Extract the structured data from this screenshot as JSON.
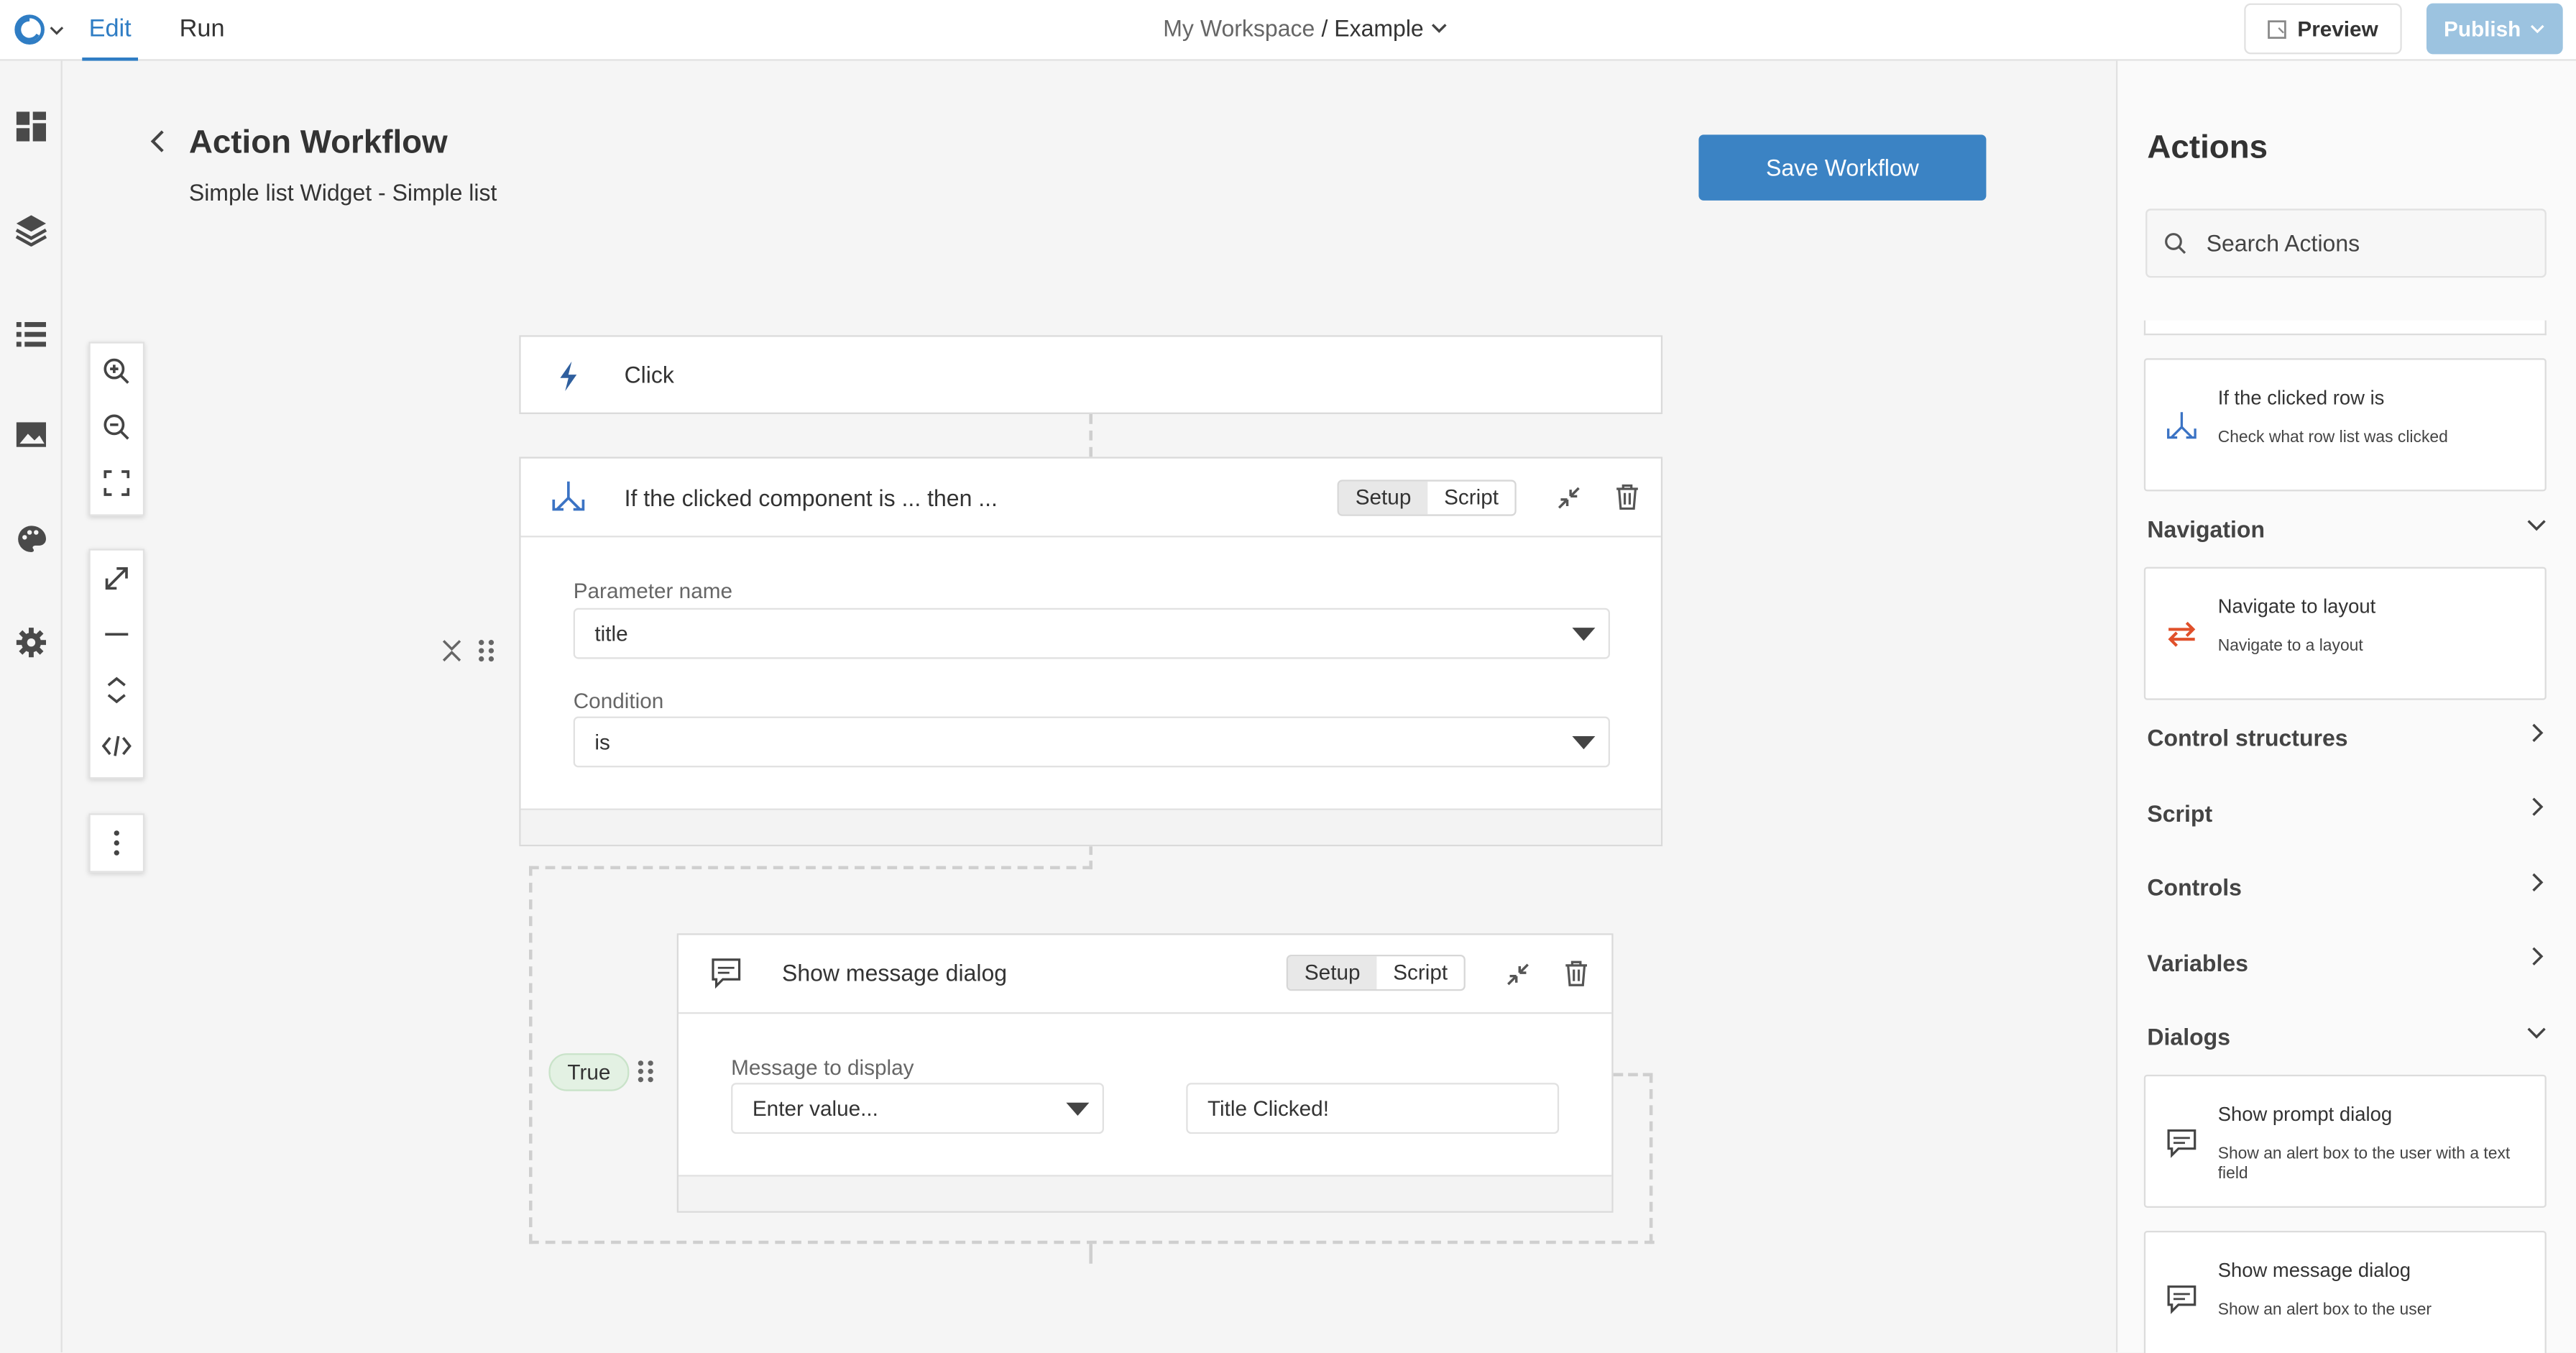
{
  "topbar": {
    "tabs": [
      {
        "label": "Edit",
        "active": true
      },
      {
        "label": "Run",
        "active": false
      }
    ],
    "breadcrumb": {
      "workspace": "My Workspace",
      "project": "/ Example"
    },
    "preview_label": "Preview",
    "publish_label": "Publish"
  },
  "sidebar": {
    "icons": [
      "dashboard-icon",
      "layers-icon",
      "list-icon",
      "image-icon",
      "palette-icon",
      "gear-icon"
    ]
  },
  "header": {
    "title": "Action Workflow",
    "subtitle": "Simple list Widget - Simple list",
    "save_label": "Save Workflow"
  },
  "toolbar": {
    "group1": [
      "zoom-in-icon",
      "zoom-out-icon",
      "fit-screen-icon"
    ],
    "group2": [
      "expand-icon",
      "collapse-icon",
      "expand-vertical-icon",
      "code-icon"
    ],
    "group3": [
      "more-vertical-icon"
    ]
  },
  "workflow": {
    "trigger": {
      "label": "Click",
      "icon": "lightning-icon"
    },
    "condition_block": {
      "title": "If the clicked component is ... then ...",
      "icon": "branch-icon",
      "tabs": [
        "Setup",
        "Script"
      ],
      "active_tab": "Setup",
      "fields": [
        {
          "label": "Parameter name",
          "value": "title"
        },
        {
          "label": "Condition",
          "value": "is"
        }
      ]
    },
    "branch_label": "True",
    "message_block": {
      "title": "Show message dialog",
      "icon": "message-icon",
      "tabs": [
        "Setup",
        "Script"
      ],
      "active_tab": "Setup",
      "field_label": "Message to display",
      "select_value": "Enter value...",
      "input_value": "Title Clicked!"
    }
  },
  "actions_panel": {
    "title": "Actions",
    "search_placeholder": "Search Actions",
    "top_card": {
      "title": "If the clicked row is",
      "desc": "Check what row list was clicked"
    },
    "sections": [
      {
        "label": "Navigation",
        "expanded": true
      },
      {
        "label": "Control structures",
        "expanded": false
      },
      {
        "label": "Script",
        "expanded": false
      },
      {
        "label": "Controls",
        "expanded": false
      },
      {
        "label": "Variables",
        "expanded": false
      },
      {
        "label": "Dialogs",
        "expanded": true
      }
    ],
    "navigation_card": {
      "title": "Navigate to layout",
      "desc": "Navigate to a layout"
    },
    "dialog_cards": [
      {
        "title": "Show prompt dialog",
        "desc": "Show an alert box to the user with a text field"
      },
      {
        "title": "Show message dialog",
        "desc": "Show an alert box to the user"
      }
    ]
  },
  "colors": {
    "accent": "#3b83c4",
    "publish": "#9cc3e0",
    "true_badge_bg": "#e3f1e3",
    "nav_icon": "#e0502a",
    "branch_icon": "#3b73c4"
  }
}
